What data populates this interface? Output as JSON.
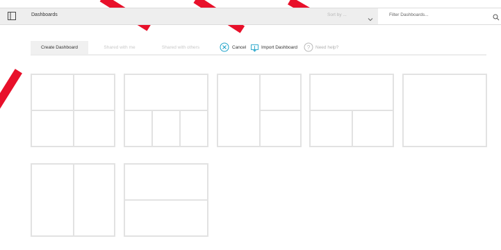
{
  "header": {
    "title": "Dashboards",
    "sort_placeholder": "Sort by ...",
    "filter_placeholder": "Filter Dashboards..."
  },
  "tabs": [
    {
      "label": "Create Dashboard",
      "active": true
    },
    {
      "label": "Shared with me",
      "active": false
    },
    {
      "label": "Shared with others",
      "active": false
    }
  ],
  "actions": {
    "cancel": "Cancel",
    "import": "Import Dashboard",
    "help": "Need help?"
  },
  "layouts": [
    {
      "name": "2x2"
    },
    {
      "name": "1 top, 3 bottom"
    },
    {
      "name": "1 left, 2 right"
    },
    {
      "name": "1 top, 2 bottom"
    },
    {
      "name": "single"
    },
    {
      "name": "2 columns"
    },
    {
      "name": "2 rows"
    }
  ],
  "colors": {
    "accent": "#1fa3c9",
    "stripe": "#e8102a"
  }
}
